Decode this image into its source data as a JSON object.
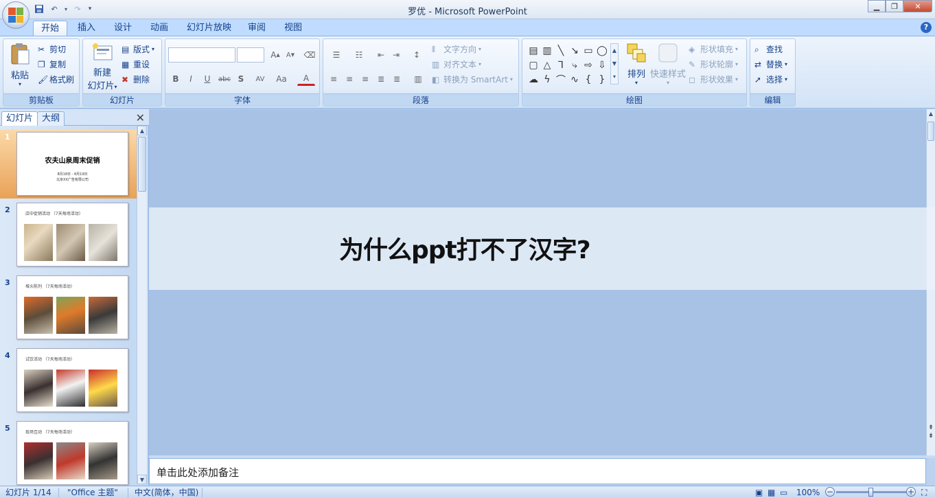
{
  "window": {
    "title": "罗优 - Microsoft PowerPoint",
    "minimize_icon": "minimize-icon",
    "maximize_icon": "restore-icon",
    "close_icon": "close-icon"
  },
  "qat": {
    "save_icon": "save-icon",
    "undo_icon": "undo-icon",
    "redo_icon": "redo-icon",
    "customize_icon": "customize-qat-icon"
  },
  "ribbon_tabs": [
    "开始",
    "插入",
    "设计",
    "动画",
    "幻灯片放映",
    "审阅",
    "视图"
  ],
  "active_tab": "开始",
  "groups": {
    "clipboard": {
      "label": "剪贴板",
      "paste": "粘贴",
      "cut": "剪切",
      "copy": "复制",
      "format_painter": "格式刷"
    },
    "slides": {
      "label": "幻灯片",
      "new_slide_line1": "新建",
      "new_slide_line2": "幻灯片",
      "layout": "版式",
      "reset": "重设",
      "delete": "删除"
    },
    "font": {
      "label": "字体",
      "font_name": "",
      "font_size": "",
      "bold": "B",
      "italic": "I",
      "underline": "U",
      "strike": "abc",
      "shadow": "S",
      "spacing": "AV",
      "case": "Aa",
      "color": "A",
      "grow": "A",
      "shrink": "A"
    },
    "paragraph": {
      "label": "段落",
      "text_direction": "文字方向",
      "align_text": "对齐文本",
      "smartart": "转换为 SmartArt"
    },
    "drawing": {
      "label": "绘图",
      "arrange": "排列",
      "quick_styles": "快速样式",
      "fill": "形状填充",
      "outline": "形状轮廓",
      "effects": "形状效果"
    },
    "editing": {
      "label": "编辑",
      "find": "查找",
      "replace": "替换",
      "select": "选择"
    }
  },
  "pane_tabs": {
    "slides": "幻灯片",
    "outline": "大纲"
  },
  "thumbnails": [
    {
      "num": "1",
      "title": "农夫山泉周末促销",
      "sub1": "8月18日 - 8月19日",
      "sub2": "北京XX广告有限公司"
    },
    {
      "num": "2",
      "caption": "店中促销活动 （7天每场活动）"
    },
    {
      "num": "3",
      "caption": "堆头陈列 （7天每场活动）"
    },
    {
      "num": "4",
      "caption": "试饮活动 （7天每场活动）"
    },
    {
      "num": "5",
      "caption": "现场互动 （7天每场活动）"
    }
  ],
  "overlay_text": "为什么ppt打不了汉字?",
  "notes_placeholder": "单击此处添加备注",
  "status": {
    "slide_index": "幻灯片 1/14",
    "theme": "\"Office 主题\"",
    "language": "中文(简体，中国)",
    "zoom": "100%"
  },
  "colors": {
    "ribbon": "#dbe8f7",
    "canvas": "#a7c2e5",
    "accent": "#15428b",
    "selected_thumb": "#e9a257"
  }
}
